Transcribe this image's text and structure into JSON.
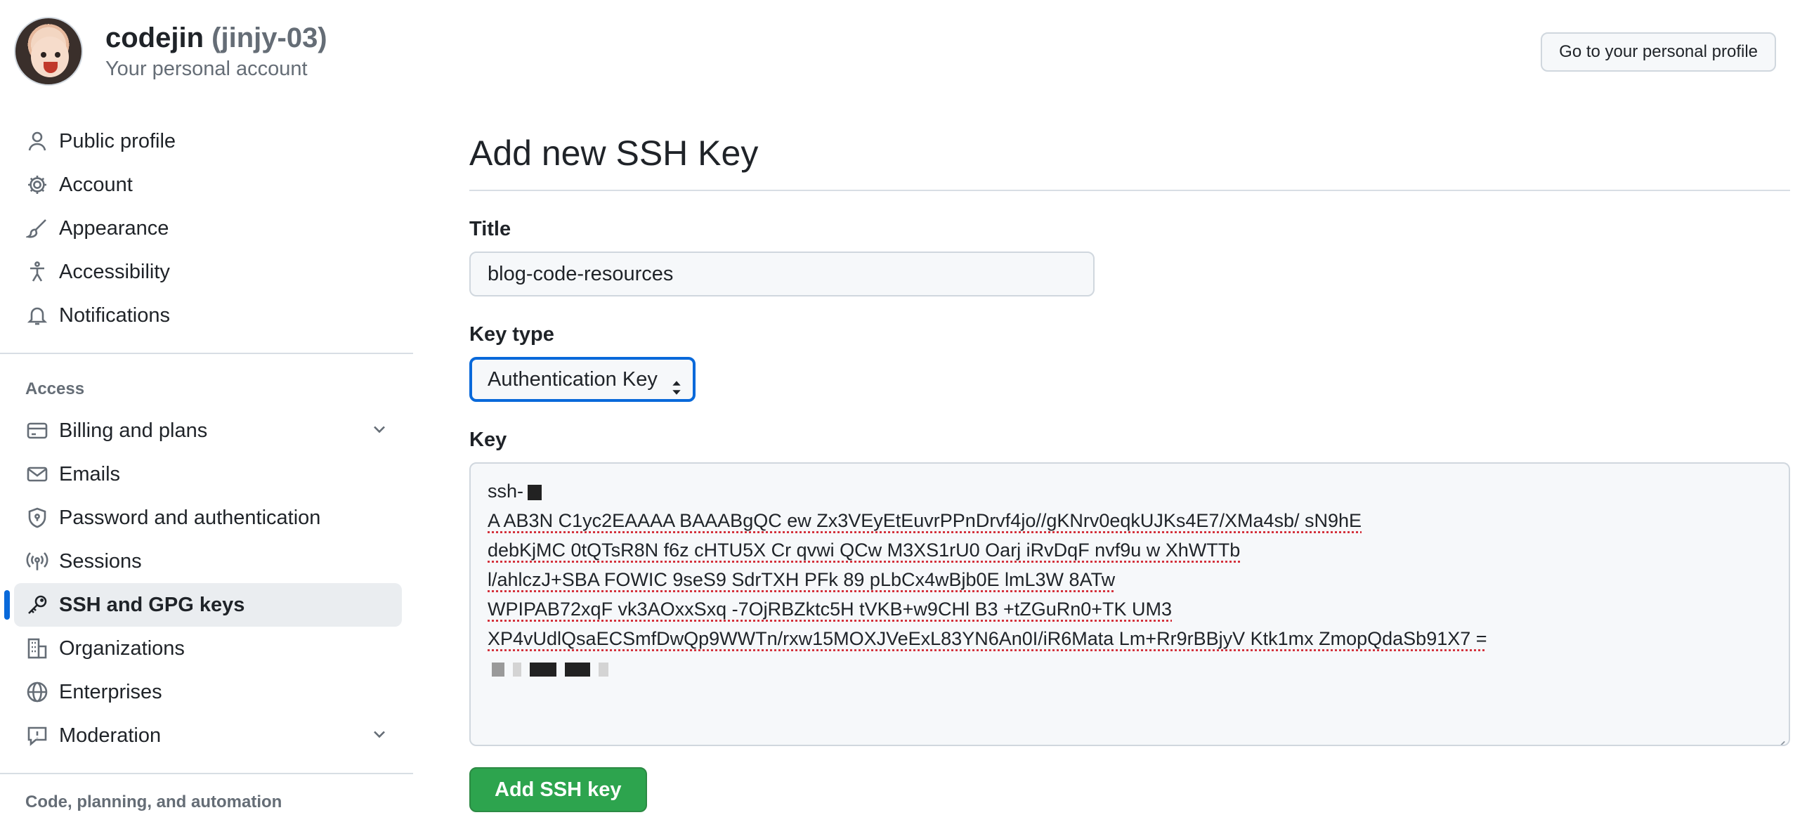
{
  "header": {
    "username": "codejin",
    "handle": "(jinjy-03)",
    "subtitle": "Your personal account",
    "profile_button": "Go to your personal profile"
  },
  "sidebar": {
    "items": [
      {
        "label": "Public profile",
        "icon": "person-icon"
      },
      {
        "label": "Account",
        "icon": "gear-icon"
      },
      {
        "label": "Appearance",
        "icon": "paintbrush-icon"
      },
      {
        "label": "Accessibility",
        "icon": "accessibility-icon"
      },
      {
        "label": "Notifications",
        "icon": "bell-icon"
      }
    ],
    "access_title": "Access",
    "access_items": [
      {
        "label": "Billing and plans",
        "icon": "credit-card-icon",
        "expandable": true
      },
      {
        "label": "Emails",
        "icon": "mail-icon"
      },
      {
        "label": "Password and authentication",
        "icon": "shield-icon"
      },
      {
        "label": "Sessions",
        "icon": "broadcast-icon"
      },
      {
        "label": "SSH and GPG keys",
        "icon": "key-icon",
        "selected": true
      },
      {
        "label": "Organizations",
        "icon": "organization-icon"
      },
      {
        "label": "Enterprises",
        "icon": "globe-icon"
      },
      {
        "label": "Moderation",
        "icon": "report-icon",
        "expandable": true
      }
    ],
    "code_title": "Code, planning, and automation"
  },
  "main": {
    "page_title": "Add new SSH Key",
    "title_label": "Title",
    "title_value": "blog-code-resources",
    "key_type_label": "Key type",
    "key_type_value": "Authentication Key",
    "key_label": "Key",
    "key_lines": [
      "ssh-",
      "A AB3N C1yc2EAAAA BAAABgQC ew Zx3VEyEtEuvrPPnDrvf4jo//gKNrv0eqkUJKs4E7/XMa4sb/ sN9hE",
      "debKjMC 0tQTsR8N f6z cHTU5X Cr qvwi QCw M3XS1rU0 Oarj iRvDqF nvf9u w XhWTTb",
      "l/ahlczJ+SBA FOWIC 9seS9 SdrTXH PFk 89 pLbCx4wBjb0E lmL3W 8ATw",
      "WPIPAB72xqF vk3AOxxSxq -7OjRBZktc5H tVKB+w9CHl B3 +tZGuRn0+TK UM3",
      "XP4vUdlQsaECSmfDwQp9WWTn/rxw15MOXJVeExL83YN6An0I/iR6Mata Lm+Rr9rBBjyV Ktk1mx ZmopQdaSb91X7 =",
      ""
    ],
    "submit_label": "Add SSH key"
  },
  "colors": {
    "accent": "#0969da",
    "primary_button": "#2da44e",
    "selected_bg": "#eaedf0"
  }
}
